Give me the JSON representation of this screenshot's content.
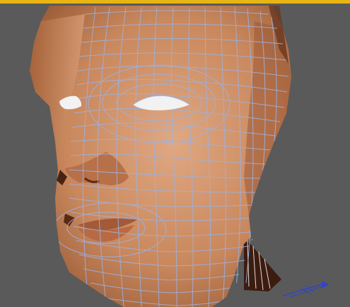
{
  "viewport": {
    "background": "#5a5a5a",
    "active_border_color": "#e8b514"
  },
  "model": {
    "skin_light": "#d69a72",
    "skin_mid": "#b8744a",
    "skin_dark": "#6e3a20",
    "wire_color": "#8fa6d6",
    "eye_color": "#f2f2f2",
    "inner_dark": "#3a1a10"
  },
  "gizmo": {
    "icon": "axis-gizmo-icon",
    "color": "#3344c8"
  }
}
